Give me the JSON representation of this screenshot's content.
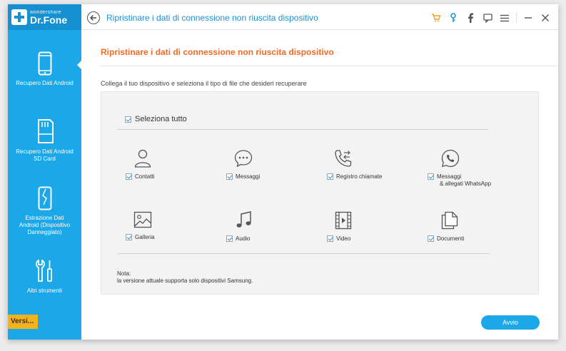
{
  "app": {
    "brand_small": "wondershare",
    "brand_name": "Dr.Fone",
    "window_title": "Ripristinare i dati di connessione non riuscita dispositivo",
    "accent_color": "#1ca7e8",
    "heading_color": "#f06a26"
  },
  "sidebar": {
    "items": [
      {
        "label": "Recupero Dati Android",
        "icon": "phone-icon"
      },
      {
        "label": "Recupero Dati Android SD Card",
        "icon": "sd-card-icon"
      },
      {
        "label": "Estrazione Dati Android (Dispositivo Danneggiato)",
        "icon": "broken-phone-icon"
      },
      {
        "label": "Altri strumenti",
        "icon": "tools-icon"
      }
    ],
    "version_label": "Versi..."
  },
  "toolbar": {
    "icons": [
      "cart-icon",
      "key-icon",
      "facebook-icon",
      "feedback-icon",
      "menu-icon",
      "minimize-icon",
      "close-icon"
    ]
  },
  "main": {
    "heading": "Ripristinare i dati di connessione non riuscita dispositivo",
    "instruction": "Collega il tuo dispositivo e seleziona il tipo di file che desideri recuperare",
    "select_all_label": "Seleziona tutto",
    "file_types": [
      {
        "label": "Contatti",
        "icon": "contacts-icon",
        "checked": true
      },
      {
        "label": "Messaggi",
        "icon": "messages-icon",
        "checked": true
      },
      {
        "label": "Registro chiamate",
        "icon": "call-log-icon",
        "checked": true
      },
      {
        "label": "Messaggi",
        "label2": "& allegati WhatsApp",
        "icon": "whatsapp-icon",
        "checked": true
      },
      {
        "label": "Galleria",
        "icon": "gallery-icon",
        "checked": true
      },
      {
        "label": "Audio",
        "icon": "audio-icon",
        "checked": true
      },
      {
        "label": "Video",
        "icon": "video-icon",
        "checked": true
      },
      {
        "label": "Documenti",
        "icon": "documents-icon",
        "checked": true
      }
    ],
    "note_title": "Nota:",
    "note_text": "la versione attuale supporta solo dispositivi Samsung.",
    "next_label": "Avvio"
  }
}
